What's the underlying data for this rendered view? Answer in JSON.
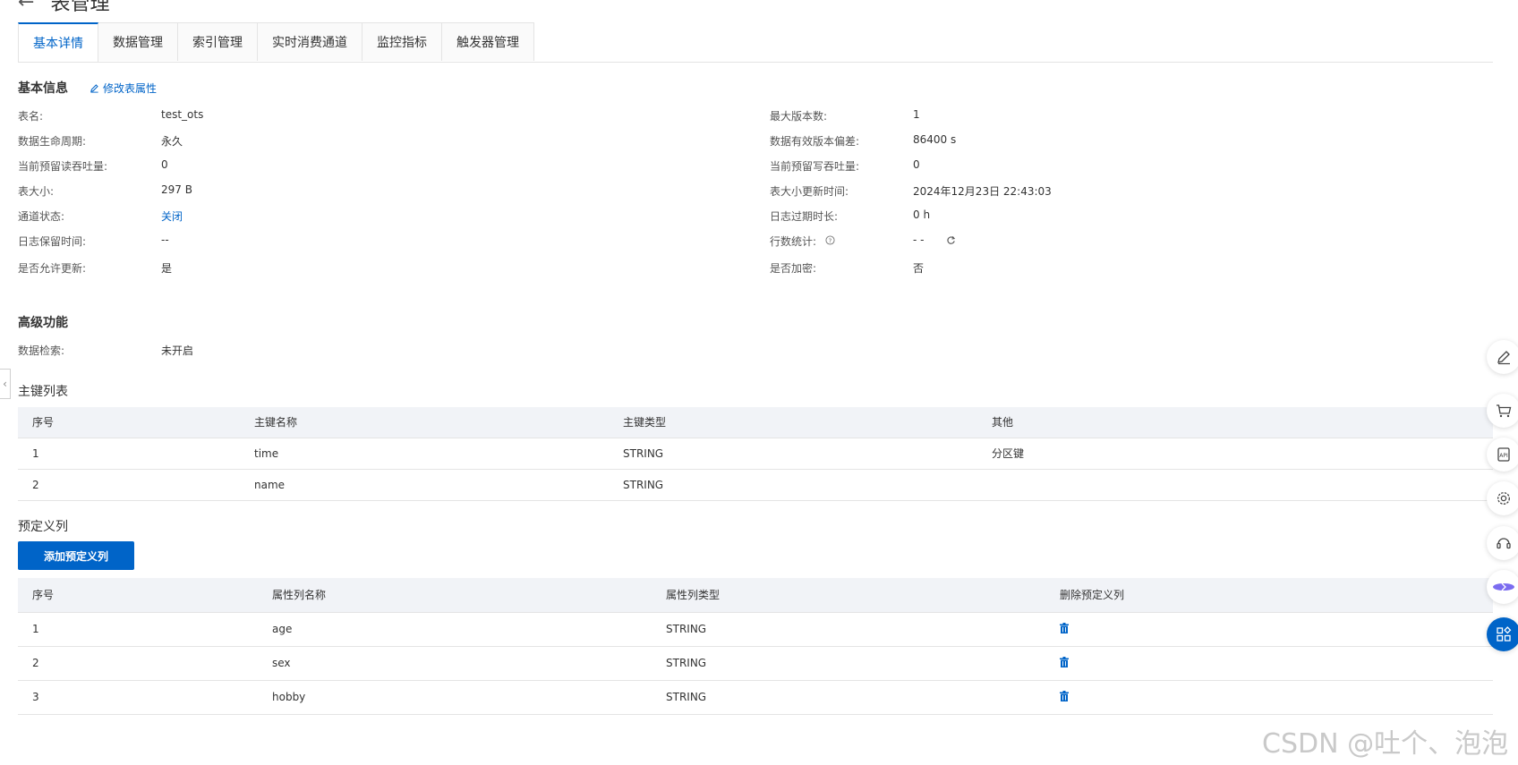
{
  "page": {
    "title": "表管理"
  },
  "tabs": [
    "基本详情",
    "数据管理",
    "索引管理",
    "实时消费通道",
    "监控指标",
    "触发器管理"
  ],
  "basic_info": {
    "title": "基本信息",
    "edit_link": "修改表属性",
    "left": [
      {
        "label": "表名:",
        "value": "test_ots"
      },
      {
        "label": "数据生命周期:",
        "value": "永久"
      },
      {
        "label": "当前预留读吞吐量:",
        "value": "0"
      },
      {
        "label": "表大小:",
        "value": "297 B"
      },
      {
        "label": "通道状态:",
        "value": "关闭"
      },
      {
        "label": "日志保留时间:",
        "value": "--"
      },
      {
        "label": "是否允许更新:",
        "value": "是"
      }
    ],
    "right": [
      {
        "label": "最大版本数:",
        "value": "1"
      },
      {
        "label": "数据有效版本偏差:",
        "value": "86400 s"
      },
      {
        "label": "当前预留写吞吐量:",
        "value": "0"
      },
      {
        "label": "表大小更新时间:",
        "value": "2024年12月23日 22:43:03"
      },
      {
        "label": "日志过期时长:",
        "value": "0 h"
      },
      {
        "label": "行数统计:",
        "value": "- -"
      },
      {
        "label": "是否加密:",
        "value": "否"
      }
    ]
  },
  "advanced": {
    "title": "高级功能",
    "label": "数据检索:",
    "value": "未开启"
  },
  "primary_keys": {
    "title": "主键列表",
    "headers": [
      "序号",
      "主键名称",
      "主键类型",
      "其他"
    ],
    "rows": [
      [
        "1",
        "time",
        "STRING",
        "分区键"
      ],
      [
        "2",
        "name",
        "STRING",
        ""
      ]
    ]
  },
  "predefined": {
    "title": "预定义列",
    "add_button": "添加预定义列",
    "headers": [
      "序号",
      "属性列名称",
      "属性列类型",
      "删除预定义列"
    ],
    "rows": [
      [
        "1",
        "age",
        "STRING"
      ],
      [
        "2",
        "sex",
        "STRING"
      ],
      [
        "3",
        "hobby",
        "STRING"
      ]
    ]
  },
  "watermark": "CSDN @吐个、泡泡",
  "colors": {
    "accent": "#0064c8",
    "header_bg": "#f1f3f7",
    "border": "#e4e4e4"
  }
}
